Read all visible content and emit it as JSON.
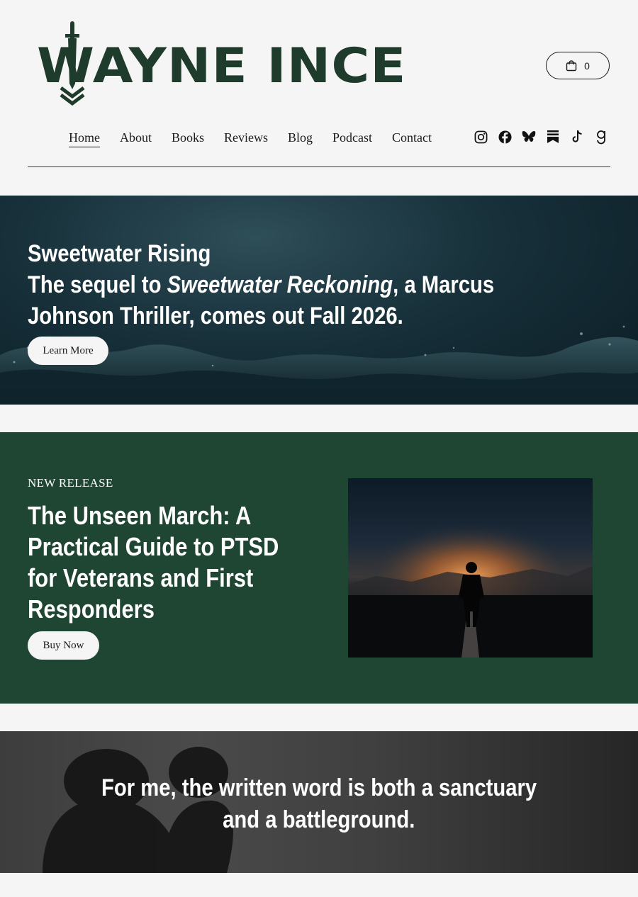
{
  "brand": {
    "name": "WAYNE INCE",
    "color": "#1f3b2c"
  },
  "cart": {
    "count": "0",
    "icon": "shopping-bag-icon"
  },
  "nav": {
    "items": [
      {
        "label": "Home",
        "active": true
      },
      {
        "label": "About"
      },
      {
        "label": "Books"
      },
      {
        "label": "Reviews"
      },
      {
        "label": "Blog"
      },
      {
        "label": "Podcast"
      },
      {
        "label": "Contact"
      }
    ]
  },
  "socials": [
    "instagram-icon",
    "facebook-icon",
    "bluesky-icon",
    "substack-icon",
    "tiktok-icon",
    "goodreads-icon"
  ],
  "hero": {
    "line1": "Sweetwater Rising",
    "line2_prefix": "The sequel to ",
    "line2_italic": "Sweetwater Reckoning",
    "line2_suffix": ", a Marcus Johnson Thriller, comes out Fall 2026.",
    "button": "Learn More"
  },
  "release": {
    "eyebrow": "NEW RELEASE",
    "title": "The Unseen March: A Practical Guide to PTSD for Veterans and First Responders",
    "button": "Buy Now",
    "background": "#1f4533"
  },
  "quote": {
    "line1": "For me, the written word is both a sanctuary",
    "line2": "and a battleground."
  }
}
